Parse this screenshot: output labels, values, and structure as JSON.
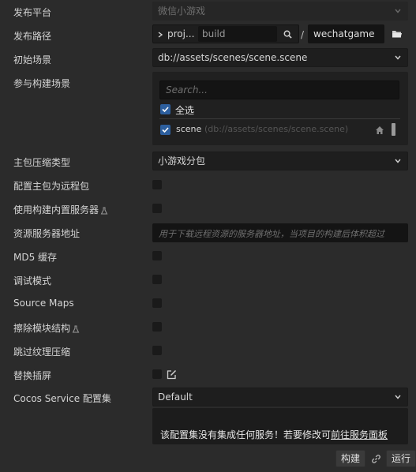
{
  "colors": {
    "background": "#2b2b2b",
    "field": "#1e1e1e",
    "accent": "#2d5f9e",
    "check": "#ffffff"
  },
  "fields": {
    "platform": {
      "label": "发布平台",
      "value": "微信小游戏"
    },
    "build_path": {
      "label": "发布路径",
      "protocol": "proj...",
      "path_value": "build",
      "folder_value": "wechatgame",
      "separator": "/"
    },
    "start_scene": {
      "label": "初始场景",
      "value": "db://assets/scenes/scene.scene"
    },
    "build_scenes": {
      "label": "参与构建场景",
      "search_placeholder": "Search...",
      "select_all_label": "全选",
      "scenes": [
        {
          "name": "scene",
          "path": "(db://assets/scenes/scene.scene)",
          "checked": true
        }
      ]
    },
    "compression": {
      "label": "主包压缩类型",
      "value": "小游戏分包"
    },
    "remote_main": {
      "label": "配置主包为远程包",
      "checked": false
    },
    "builtin_server": {
      "label": "使用构建内置服务器",
      "checked": false
    },
    "server_address": {
      "label": "资源服务器地址",
      "placeholder": "用于下载远程资源的服务器地址，当项目的构建后体积超过"
    },
    "md5": {
      "label": "MD5 缓存",
      "checked": false
    },
    "debug": {
      "label": "调试模式",
      "checked": false
    },
    "source_maps": {
      "label": "Source Maps",
      "checked": false
    },
    "erase_modules": {
      "label": "擦除模块结构",
      "checked": false
    },
    "skip_texture": {
      "label": "跳过纹理压缩",
      "checked": false
    },
    "splash": {
      "label": "替换插屏",
      "checked": false
    },
    "cocos_service": {
      "label": "Cocos Service 配置集",
      "value": "Default",
      "notice_text": "该配置集没有集成任何服务！若要修改可",
      "notice_link": "前往服务面板"
    }
  },
  "footer": {
    "build_label": "构建",
    "run_label": "运行"
  },
  "icons": {
    "search": "search-icon",
    "folder": "folder-icon",
    "home": "home-icon",
    "lab": "lab-flask-icon",
    "edit": "edit-icon",
    "link": "link-icon",
    "chevron": "chevron-down-icon",
    "check": "check-icon"
  }
}
